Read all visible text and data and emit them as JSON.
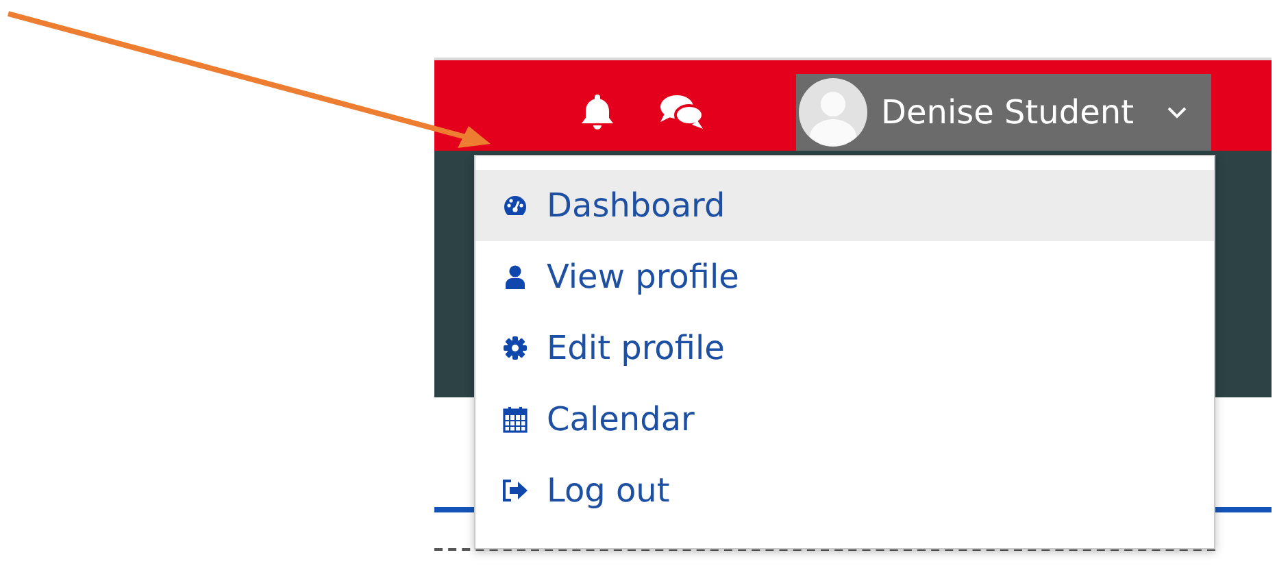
{
  "navbar": {
    "user_name": "Denise Student"
  },
  "user_menu": {
    "expanded": true,
    "items": [
      {
        "label": "Dashboard",
        "kind": "dashboard",
        "selected": true
      },
      {
        "label": "View profile",
        "kind": "profile",
        "selected": false
      },
      {
        "label": "Edit profile",
        "kind": "settings",
        "selected": false
      },
      {
        "label": "Calendar",
        "kind": "calendar",
        "selected": false
      },
      {
        "label": "Log out",
        "kind": "logout",
        "selected": false
      }
    ]
  }
}
